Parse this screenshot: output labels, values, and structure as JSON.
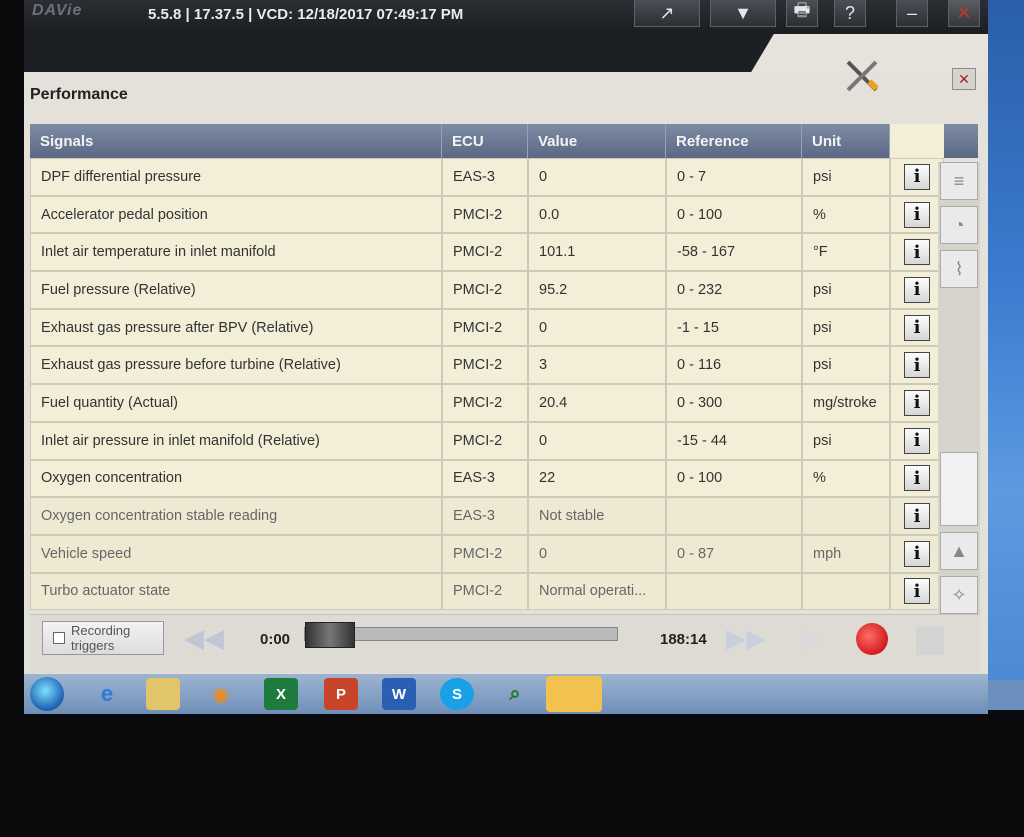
{
  "header": {
    "logo_text": "DAVie",
    "version": "5.5.8 | 17.37.5 | VCD: 12/18/2017 07:49:17 PM",
    "buttons": [
      "↗",
      "▼",
      "🖶",
      "?",
      "–",
      "✕"
    ]
  },
  "panel": {
    "title": "Performance",
    "close_label": "✕"
  },
  "table": {
    "columns": [
      "Signals",
      "ECU",
      "Value",
      "Reference",
      "Unit"
    ],
    "rows": [
      {
        "signal": "DPF differential pressure",
        "ecu": "EAS-3",
        "value": "0",
        "reference": "0 - 7",
        "unit": "psi"
      },
      {
        "signal": "Accelerator pedal position",
        "ecu": "PMCI-2",
        "value": "0.0",
        "reference": "0 - 100",
        "unit": "%"
      },
      {
        "signal": "Inlet air temperature in inlet manifold",
        "ecu": "PMCI-2",
        "value": "101.1",
        "reference": "-58 - 167",
        "unit": "°F"
      },
      {
        "signal": "Fuel pressure (Relative)",
        "ecu": "PMCI-2",
        "value": "95.2",
        "reference": "0 - 232",
        "unit": "psi"
      },
      {
        "signal": "Exhaust gas pressure after BPV (Relative)",
        "ecu": "PMCI-2",
        "value": "0",
        "reference": "-1 - 15",
        "unit": "psi"
      },
      {
        "signal": "Exhaust gas pressure before turbine (Relative)",
        "ecu": "PMCI-2",
        "value": "3",
        "reference": "0 - 116",
        "unit": "psi"
      },
      {
        "signal": "Fuel quantity (Actual)",
        "ecu": "PMCI-2",
        "value": "20.4",
        "reference": "0 - 300",
        "unit": "mg/stroke"
      },
      {
        "signal": "Inlet air pressure in inlet manifold (Relative)",
        "ecu": "PMCI-2",
        "value": "0",
        "reference": "-15 - 44",
        "unit": "psi"
      },
      {
        "signal": "Oxygen concentration",
        "ecu": "EAS-3",
        "value": "22",
        "reference": "0 - 100",
        "unit": "%"
      },
      {
        "signal": "Oxygen concentration stable reading",
        "ecu": "EAS-3",
        "value": "Not stable",
        "reference": "",
        "unit": ""
      },
      {
        "signal": "Vehicle speed",
        "ecu": "PMCI-2",
        "value": "0",
        "reference": "0 - 87",
        "unit": "mph"
      },
      {
        "signal": "Turbo actuator state",
        "ecu": "PMCI-2",
        "value": "Normal operati...",
        "reference": "",
        "unit": ""
      }
    ],
    "info_label": "i"
  },
  "playback": {
    "recording_triggers_label": "Recording triggers",
    "time_start": "0:00",
    "time_end": "188:14"
  },
  "taskbar": {
    "excel_label": "X",
    "ppt_label": "P",
    "word_label": "W",
    "skype_label": "S"
  }
}
